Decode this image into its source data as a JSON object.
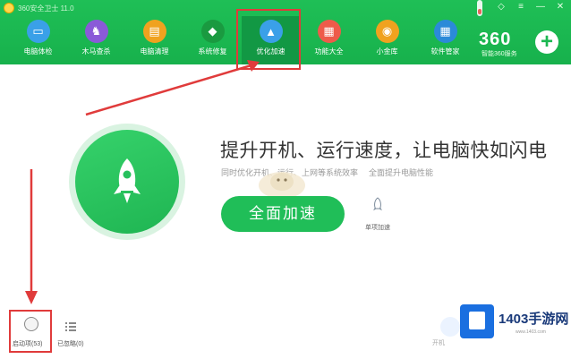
{
  "window": {
    "title": "360安全卫士 11.0",
    "controls": [
      "skin-icon",
      "menu-icon",
      "minimize-icon",
      "close-icon"
    ]
  },
  "nav": {
    "items": [
      {
        "label": "电脑体检",
        "icon": "monitor-icon",
        "color": "#3aa0e8"
      },
      {
        "label": "木马查杀",
        "icon": "horse-icon",
        "color": "#8a5ad8"
      },
      {
        "label": "电脑清理",
        "icon": "broom-icon",
        "color": "#f0a21f"
      },
      {
        "label": "系统修复",
        "icon": "shield-icon",
        "color": "#1a9a40"
      },
      {
        "label": "优化加速",
        "icon": "rocket-icon",
        "color": "#3aa0e8",
        "active": true
      },
      {
        "label": "功能大全",
        "icon": "apps-icon",
        "color": "#ee5b4a"
      },
      {
        "label": "小金库",
        "icon": "coin-icon",
        "color": "#f0a21f"
      },
      {
        "label": "软件管家",
        "icon": "grid-icon",
        "color": "#2b8ad8"
      }
    ]
  },
  "brand": {
    "name": "360",
    "subtitle": "智能360服务"
  },
  "main": {
    "headline": "提升开机、运行速度，让电脑快如闪电",
    "subline": "同时优化开机、运行、上网等系统效率",
    "subline2": "全面提升电脑性能",
    "accelerate_button": "全面加速",
    "single_accelerate": "单项加速"
  },
  "bottom": {
    "startup_label": "启动项(53)",
    "ignored_label": "已忽略(0)"
  },
  "watermark": {
    "title": "1403手游网",
    "url": "www.1403.com",
    "faint": "开机"
  },
  "colors": {
    "primary": "#20be58",
    "highlight": "#e03b3b",
    "text": "#333333"
  }
}
